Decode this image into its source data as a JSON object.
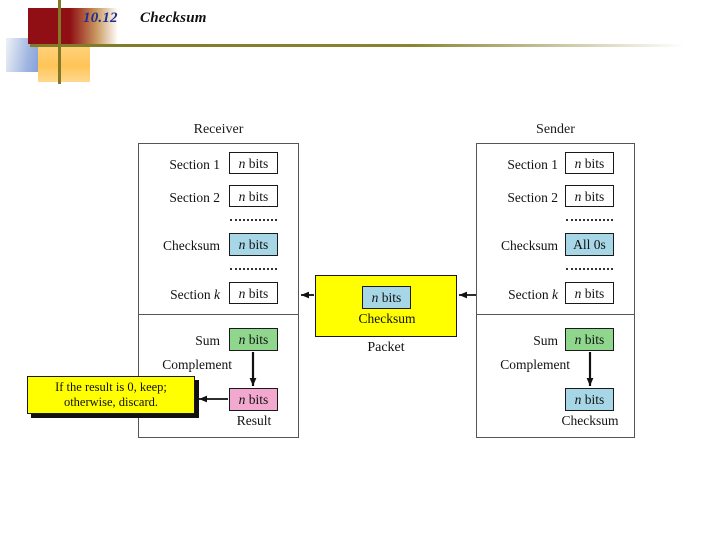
{
  "header": {
    "number": "10.12",
    "title": "Checksum"
  },
  "figure": {
    "receiver": {
      "caption": "Receiver",
      "rows": [
        {
          "label": "Section 1",
          "value": "n bits",
          "fill": "none"
        },
        {
          "label": "Section 2",
          "value": "n bits",
          "fill": "none"
        },
        {
          "label": "Checksum",
          "value": "n bits",
          "fill": "cyan"
        },
        {
          "label": "Section k",
          "value": "n bits",
          "fill": "none"
        }
      ],
      "sum_label": "Sum",
      "sum_value": "n bits",
      "complement_label": "Complement",
      "result_value": "n bits",
      "result_caption": "Result"
    },
    "sender": {
      "caption": "Sender",
      "rows": [
        {
          "label": "Section 1",
          "value": "n bits",
          "fill": "none"
        },
        {
          "label": "Section 2",
          "value": "n bits",
          "fill": "none"
        },
        {
          "label": "Checksum",
          "value": "All 0s",
          "fill": "cyan"
        },
        {
          "label": "Section k",
          "value": "n bits",
          "fill": "none"
        }
      ],
      "sum_label": "Sum",
      "sum_value": "n bits",
      "complement_label": "Complement",
      "checksum_value": "n bits",
      "checksum_caption": "Checksum"
    },
    "packet": {
      "label": "Packet",
      "inner_value": "n bits",
      "inner_caption": "Checksum"
    },
    "callout": {
      "line1": "If the result is 0, keep;",
      "line2": "otherwise, discard."
    }
  },
  "colors": {
    "cyan": "#a7d6e6",
    "green": "#8fd78d",
    "pink": "#f3a9cf",
    "yellow": "#ffff00",
    "header_number": "#1f2f8f",
    "deco_red": "#8f0f14",
    "deco_olive": "#807a29"
  }
}
